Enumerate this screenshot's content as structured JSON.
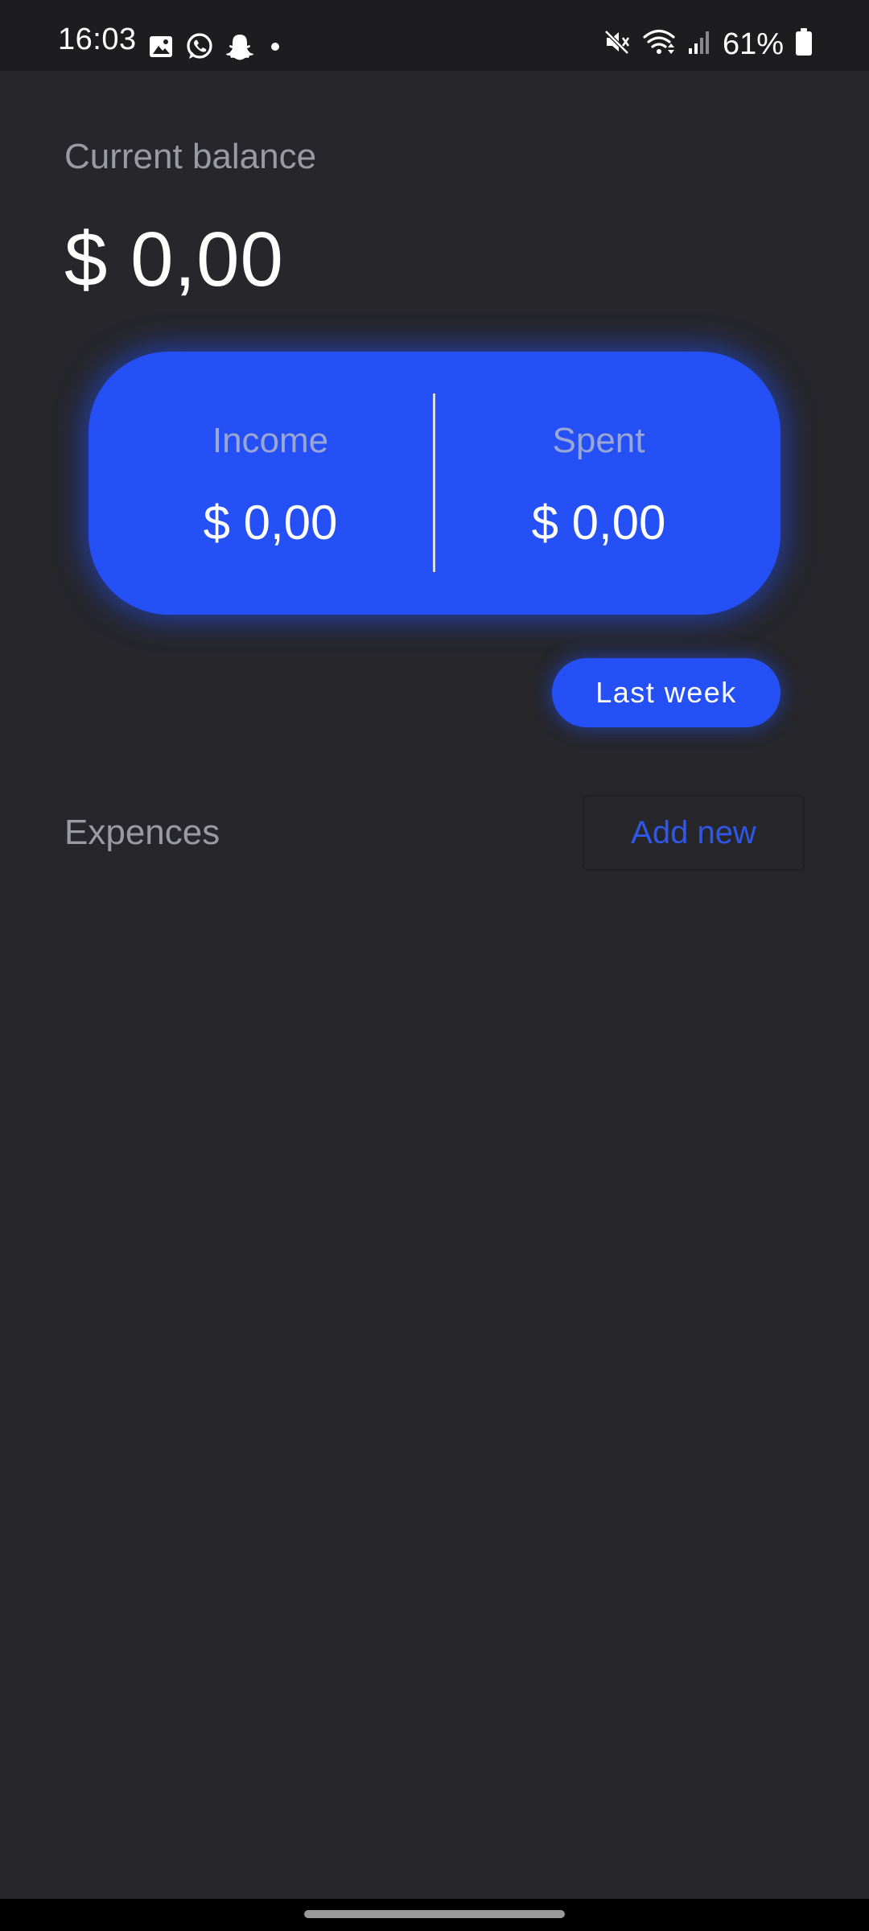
{
  "status_bar": {
    "time": "16:03",
    "left_icons": [
      "gallery-icon",
      "whatsapp-icon",
      "snapchat-icon",
      "dot-icon"
    ],
    "right_icons": [
      "mute-icon",
      "wifi-icon",
      "signal-icon",
      "battery-icon"
    ],
    "battery_percent": "61%"
  },
  "balance": {
    "label": "Current balance",
    "value": "$ 0,00"
  },
  "summary": {
    "income_label": "Income",
    "income_value": "$ 0,00",
    "spent_label": "Spent",
    "spent_value": "$ 0,00"
  },
  "period_button": {
    "label": "Last week"
  },
  "expenses": {
    "title": "Expences",
    "add_label": "Add new",
    "items": []
  },
  "colors": {
    "background": "#26262b",
    "accent": "#2450f5",
    "muted_text": "#9a9aa1"
  }
}
